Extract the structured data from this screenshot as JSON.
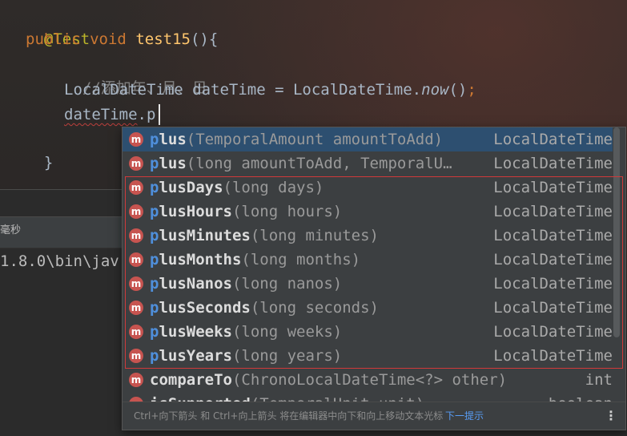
{
  "editor": {
    "lines": {
      "annotation": "@Test",
      "sig_public": "public",
      "sig_void": "void",
      "sig_name": "test15",
      "sig_rest": "(){",
      "comment": "//添加年、月、日",
      "decl_type": "LocalDateTime dateTime = LocalDateTime.",
      "decl_call": "now",
      "decl_parens": "()",
      "decl_semi": ";",
      "typing_var": "dateTime",
      "typing_rest": ".p",
      "closing_brace": "}"
    }
  },
  "run_panel": {
    "tab_text": "毫秒",
    "console_text": "1.8.0\\bin\\jav"
  },
  "completion": {
    "items": [
      {
        "icon": "m",
        "match": "p",
        "rest": "lus",
        "params": "(TemporalAmount amountToAdd)",
        "type": "LocalDateTime"
      },
      {
        "icon": "m",
        "match": "p",
        "rest": "lus",
        "params": "(long amountToAdd, TemporalU…",
        "type": "LocalDateTime"
      },
      {
        "icon": "m",
        "match": "p",
        "rest": "lusDays",
        "params": "(long days)",
        "type": "LocalDateTime"
      },
      {
        "icon": "m",
        "match": "p",
        "rest": "lusHours",
        "params": "(long hours)",
        "type": "LocalDateTime"
      },
      {
        "icon": "m",
        "match": "p",
        "rest": "lusMinutes",
        "params": "(long minutes)",
        "type": "LocalDateTime"
      },
      {
        "icon": "m",
        "match": "p",
        "rest": "lusMonths",
        "params": "(long months)",
        "type": "LocalDateTime"
      },
      {
        "icon": "m",
        "match": "p",
        "rest": "lusNanos",
        "params": "(long nanos)",
        "type": "LocalDateTime"
      },
      {
        "icon": "m",
        "match": "p",
        "rest": "lusSeconds",
        "params": "(long seconds)",
        "type": "LocalDateTime"
      },
      {
        "icon": "m",
        "match": "p",
        "rest": "lusWeeks",
        "params": "(long weeks)",
        "type": "LocalDateTime"
      },
      {
        "icon": "m",
        "match": "p",
        "rest": "lusYears",
        "params": "(long years)",
        "type": "LocalDateTime"
      },
      {
        "icon": "m",
        "match": "",
        "rest": "compareTo",
        "params": "(ChronoLocalDateTime<?> other)",
        "type": "int"
      },
      {
        "icon": "m",
        "match": "",
        "rest": "isSupported",
        "params": "(TemporalUnit unit)",
        "type": "boolean"
      }
    ],
    "footer_hint": "Ctrl+向下箭头 和 Ctrl+向上箭头 将在编辑器中向下和向上移动文本光标",
    "footer_link": "下一提示",
    "more_glyph": "⋮"
  },
  "colors": {
    "keyword": "#cc7832",
    "method_decl": "#ffc66d",
    "annotation": "#bbb529",
    "match_highlight": "#4f8fdb",
    "method_icon": "#c75450",
    "highlight_box": "#d03a3a"
  }
}
